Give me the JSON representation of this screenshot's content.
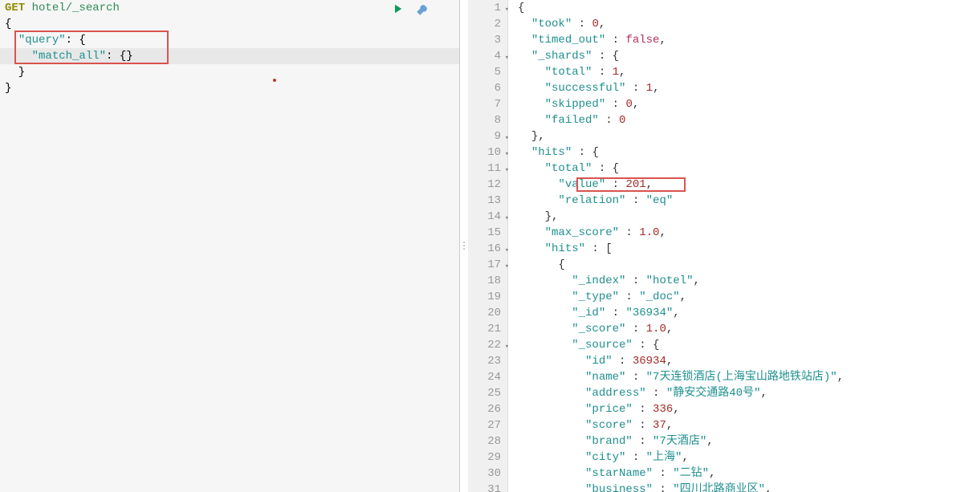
{
  "request": {
    "method": "GET",
    "path": "hotel/_search",
    "body_lines": [
      "{",
      "  \"query\": {",
      "    \"match_all\": {}",
      "  }",
      "}"
    ]
  },
  "response_lines": [
    {
      "n": 1,
      "fold": true,
      "ind": 0,
      "t": [
        [
          "plain",
          "{"
        ]
      ]
    },
    {
      "n": 2,
      "fold": false,
      "ind": 1,
      "t": [
        [
          "key",
          "\"took\""
        ],
        [
          "plain",
          " : "
        ],
        [
          "num",
          "0"
        ],
        [
          "plain",
          ","
        ]
      ]
    },
    {
      "n": 3,
      "fold": false,
      "ind": 1,
      "t": [
        [
          "key",
          "\"timed_out\""
        ],
        [
          "plain",
          " : "
        ],
        [
          "bool",
          "false"
        ],
        [
          "plain",
          ","
        ]
      ]
    },
    {
      "n": 4,
      "fold": true,
      "ind": 1,
      "t": [
        [
          "key",
          "\"_shards\""
        ],
        [
          "plain",
          " : {"
        ]
      ]
    },
    {
      "n": 5,
      "fold": false,
      "ind": 2,
      "t": [
        [
          "key",
          "\"total\""
        ],
        [
          "plain",
          " : "
        ],
        [
          "num",
          "1"
        ],
        [
          "plain",
          ","
        ]
      ]
    },
    {
      "n": 6,
      "fold": false,
      "ind": 2,
      "t": [
        [
          "key",
          "\"successful\""
        ],
        [
          "plain",
          " : "
        ],
        [
          "num",
          "1"
        ],
        [
          "plain",
          ","
        ]
      ]
    },
    {
      "n": 7,
      "fold": false,
      "ind": 2,
      "t": [
        [
          "key",
          "\"skipped\""
        ],
        [
          "plain",
          " : "
        ],
        [
          "num",
          "0"
        ],
        [
          "plain",
          ","
        ]
      ]
    },
    {
      "n": 8,
      "fold": false,
      "ind": 2,
      "t": [
        [
          "key",
          "\"failed\""
        ],
        [
          "plain",
          " : "
        ],
        [
          "num",
          "0"
        ]
      ]
    },
    {
      "n": 9,
      "fold": true,
      "ind": 1,
      "t": [
        [
          "plain",
          "},"
        ]
      ]
    },
    {
      "n": 10,
      "fold": true,
      "ind": 1,
      "t": [
        [
          "key",
          "\"hits\""
        ],
        [
          "plain",
          " : {"
        ]
      ]
    },
    {
      "n": 11,
      "fold": true,
      "ind": 2,
      "t": [
        [
          "key",
          "\"total\""
        ],
        [
          "plain",
          " : {"
        ]
      ]
    },
    {
      "n": 12,
      "fold": false,
      "ind": 3,
      "t": [
        [
          "key",
          "\"value\""
        ],
        [
          "plain",
          " : "
        ],
        [
          "num",
          "201"
        ],
        [
          "plain",
          ","
        ]
      ]
    },
    {
      "n": 13,
      "fold": false,
      "ind": 3,
      "t": [
        [
          "key",
          "\"relation\""
        ],
        [
          "plain",
          " : "
        ],
        [
          "str",
          "\"eq\""
        ]
      ]
    },
    {
      "n": 14,
      "fold": true,
      "ind": 2,
      "t": [
        [
          "plain",
          "},"
        ]
      ]
    },
    {
      "n": 15,
      "fold": false,
      "ind": 2,
      "t": [
        [
          "key",
          "\"max_score\""
        ],
        [
          "plain",
          " : "
        ],
        [
          "num",
          "1.0"
        ],
        [
          "plain",
          ","
        ]
      ]
    },
    {
      "n": 16,
      "fold": true,
      "ind": 2,
      "t": [
        [
          "key",
          "\"hits\""
        ],
        [
          "plain",
          " : ["
        ]
      ]
    },
    {
      "n": 17,
      "fold": true,
      "ind": 3,
      "t": [
        [
          "plain",
          "{"
        ]
      ]
    },
    {
      "n": 18,
      "fold": false,
      "ind": 4,
      "t": [
        [
          "key",
          "\"_index\""
        ],
        [
          "plain",
          " : "
        ],
        [
          "str",
          "\"hotel\""
        ],
        [
          "plain",
          ","
        ]
      ]
    },
    {
      "n": 19,
      "fold": false,
      "ind": 4,
      "t": [
        [
          "key",
          "\"_type\""
        ],
        [
          "plain",
          " : "
        ],
        [
          "str",
          "\"_doc\""
        ],
        [
          "plain",
          ","
        ]
      ]
    },
    {
      "n": 20,
      "fold": false,
      "ind": 4,
      "t": [
        [
          "key",
          "\"_id\""
        ],
        [
          "plain",
          " : "
        ],
        [
          "str",
          "\"36934\""
        ],
        [
          "plain",
          ","
        ]
      ]
    },
    {
      "n": 21,
      "fold": false,
      "ind": 4,
      "t": [
        [
          "key",
          "\"_score\""
        ],
        [
          "plain",
          " : "
        ],
        [
          "num",
          "1.0"
        ],
        [
          "plain",
          ","
        ]
      ]
    },
    {
      "n": 22,
      "fold": true,
      "ind": 4,
      "t": [
        [
          "key",
          "\"_source\""
        ],
        [
          "plain",
          " : {"
        ]
      ]
    },
    {
      "n": 23,
      "fold": false,
      "ind": 5,
      "t": [
        [
          "key",
          "\"id\""
        ],
        [
          "plain",
          " : "
        ],
        [
          "num",
          "36934"
        ],
        [
          "plain",
          ","
        ]
      ]
    },
    {
      "n": 24,
      "fold": false,
      "ind": 5,
      "t": [
        [
          "key",
          "\"name\""
        ],
        [
          "plain",
          " : "
        ],
        [
          "str",
          "\"7天连锁酒店(上海宝山路地铁站店)\""
        ],
        [
          "plain",
          ","
        ]
      ]
    },
    {
      "n": 25,
      "fold": false,
      "ind": 5,
      "t": [
        [
          "key",
          "\"address\""
        ],
        [
          "plain",
          " : "
        ],
        [
          "str",
          "\"静安交通路40号\""
        ],
        [
          "plain",
          ","
        ]
      ]
    },
    {
      "n": 26,
      "fold": false,
      "ind": 5,
      "t": [
        [
          "key",
          "\"price\""
        ],
        [
          "plain",
          " : "
        ],
        [
          "num",
          "336"
        ],
        [
          "plain",
          ","
        ]
      ]
    },
    {
      "n": 27,
      "fold": false,
      "ind": 5,
      "t": [
        [
          "key",
          "\"score\""
        ],
        [
          "plain",
          " : "
        ],
        [
          "num",
          "37"
        ],
        [
          "plain",
          ","
        ]
      ]
    },
    {
      "n": 28,
      "fold": false,
      "ind": 5,
      "t": [
        [
          "key",
          "\"brand\""
        ],
        [
          "plain",
          " : "
        ],
        [
          "str",
          "\"7天酒店\""
        ],
        [
          "plain",
          ","
        ]
      ]
    },
    {
      "n": 29,
      "fold": false,
      "ind": 5,
      "t": [
        [
          "key",
          "\"city\""
        ],
        [
          "plain",
          " : "
        ],
        [
          "str",
          "\"上海\""
        ],
        [
          "plain",
          ","
        ]
      ]
    },
    {
      "n": 30,
      "fold": false,
      "ind": 5,
      "t": [
        [
          "key",
          "\"starName\""
        ],
        [
          "plain",
          " : "
        ],
        [
          "str",
          "\"二钻\""
        ],
        [
          "plain",
          ","
        ]
      ]
    },
    {
      "n": 31,
      "fold": false,
      "ind": 5,
      "t": [
        [
          "key",
          "\"business\""
        ],
        [
          "plain",
          " : "
        ],
        [
          "str",
          "\"四川北路商业区\""
        ],
        [
          "plain",
          ","
        ]
      ]
    }
  ],
  "annotations": {
    "query_box": "query / match_all",
    "value_box": "hits.total.value = 201"
  }
}
